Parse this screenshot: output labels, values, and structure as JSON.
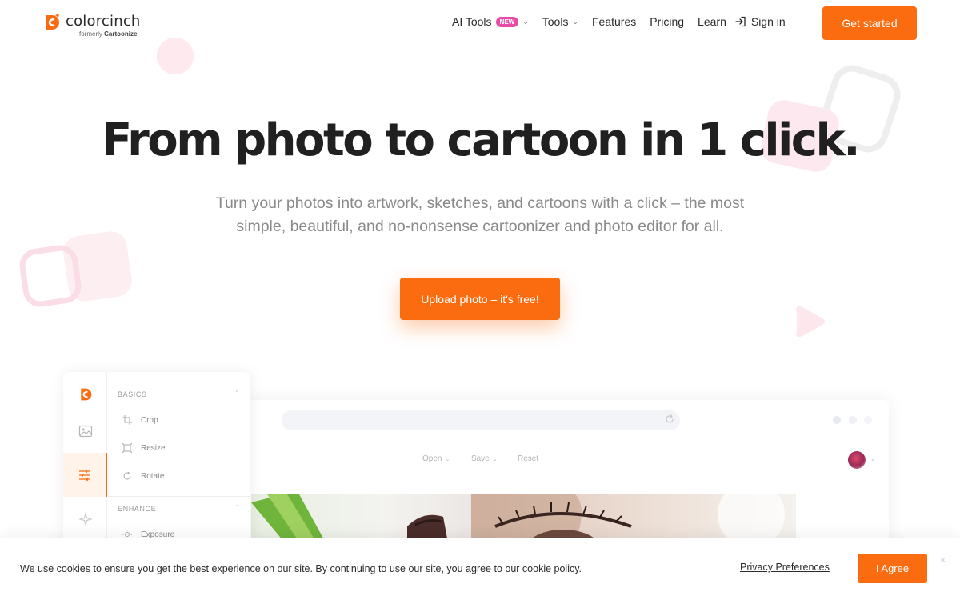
{
  "brand": {
    "name": "colorcinch",
    "formerly_prefix": "formerly",
    "formerly_name": "Cartoonize",
    "accent_color": "#fb6b0f",
    "badge_color": "#e94aa6"
  },
  "nav": {
    "items": [
      {
        "label": "AI Tools",
        "badge": "NEW",
        "has_dropdown": true
      },
      {
        "label": "Tools",
        "has_dropdown": true
      },
      {
        "label": "Features"
      },
      {
        "label": "Pricing"
      },
      {
        "label": "Learn"
      }
    ],
    "signin_label": "Sign in",
    "cta_label": "Get started"
  },
  "hero": {
    "title": "From photo to cartoon in 1 click.",
    "subtitle_line1": "Turn your photos into artwork, sketches, and cartoons with a click – the most",
    "subtitle_line2": "simple, beautiful, and no-nonsense cartoonizer and photo editor for all.",
    "cta_label": "Upload photo – it's free!"
  },
  "editor_preview": {
    "toolbar": [
      "Open",
      "Save",
      "Reset"
    ],
    "sections": [
      {
        "title": "BASICS",
        "tools": [
          "Crop",
          "Resize",
          "Rotate"
        ]
      },
      {
        "title": "ENHANCE",
        "tools": [
          "Exposure"
        ]
      }
    ],
    "rail_icons": [
      "logo-icon",
      "image-icon",
      "sliders-icon",
      "sparkle-icon"
    ]
  },
  "cookie": {
    "text": "We use cookies to ensure you get the best experience on our site. By continuing to use our site, you agree to our cookie policy.",
    "link_label": "Privacy Preferences",
    "agree_label": "I Agree",
    "close_glyph": "×"
  }
}
